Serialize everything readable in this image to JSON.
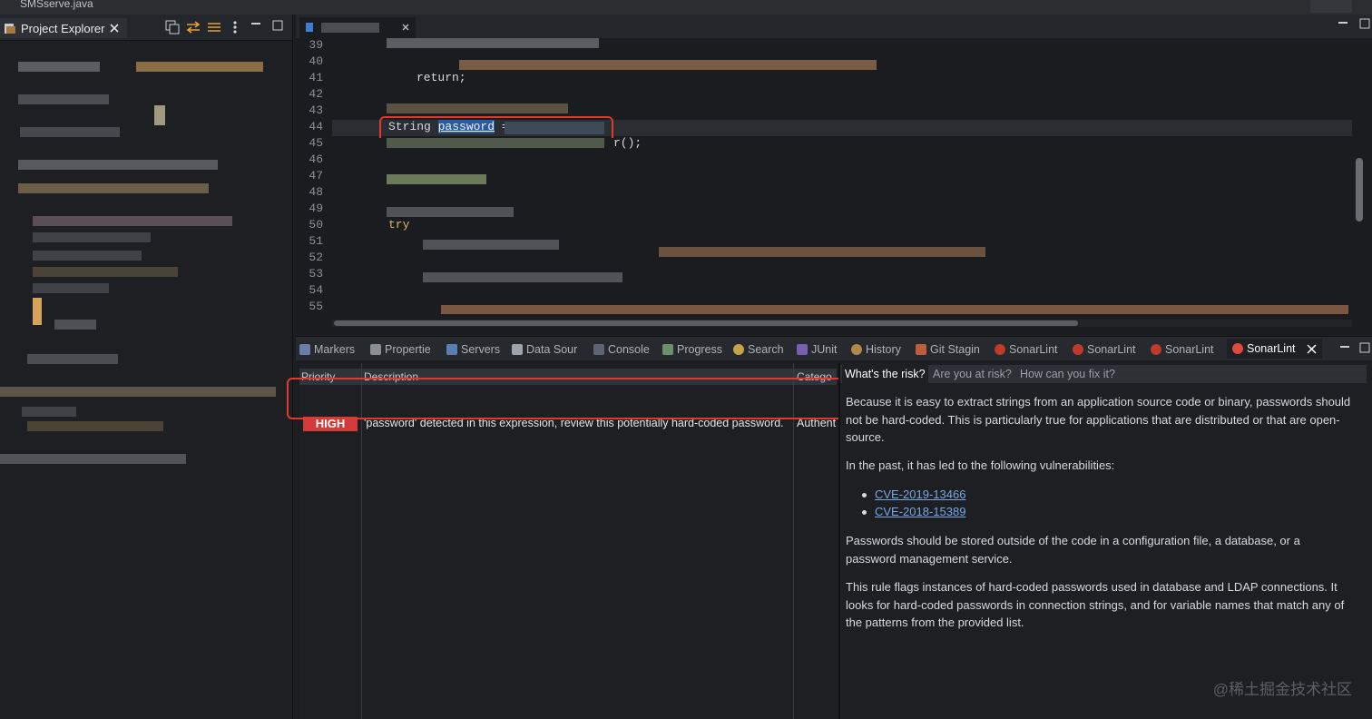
{
  "window": {
    "title": "SMSserve.java"
  },
  "explorer": {
    "tab_label": "Project Explorer"
  },
  "editor": {
    "line_numbers": [
      "39",
      "40",
      "41",
      "42",
      "43",
      "44",
      "45",
      "46",
      "47",
      "48",
      "49",
      "50",
      "51",
      "52",
      "53",
      "54",
      "55"
    ],
    "visible_code": {
      "return_stmt": "return;",
      "password_line_prefix": "String ",
      "password_var": "password",
      "password_line_suffix": " =",
      "line45_tail": "r();",
      "try_kw": "try"
    }
  },
  "views": {
    "tabs": [
      {
        "label": "Markers",
        "icon": "markers-icon"
      },
      {
        "label": "Propertie",
        "icon": "properties-icon"
      },
      {
        "label": "Servers",
        "icon": "servers-icon"
      },
      {
        "label": "Data Sour",
        "icon": "datasource-icon"
      },
      {
        "label": "Console",
        "icon": "console-icon"
      },
      {
        "label": "Progress",
        "icon": "progress-icon"
      },
      {
        "label": "Search",
        "icon": "search-icon"
      },
      {
        "label": "JUnit",
        "icon": "junit-icon"
      },
      {
        "label": "History",
        "icon": "history-icon"
      },
      {
        "label": "Git Stagin",
        "icon": "git-icon"
      },
      {
        "label": "SonarLint",
        "icon": "sonarlint-icon"
      },
      {
        "label": "SonarLint",
        "icon": "sonarlint-icon"
      },
      {
        "label": "SonarLint",
        "icon": "sonarlint-icon"
      },
      {
        "label": "SonarLint",
        "icon": "sonarlint-icon",
        "active": true
      }
    ]
  },
  "issues": {
    "columns": [
      "Priority",
      "Description",
      "Catego"
    ],
    "rows": [
      {
        "priority": "HIGH",
        "description": "'password' detected in this expression, review this potentially hard-coded password.",
        "category": "Authent"
      }
    ]
  },
  "details": {
    "tabs": [
      "What's the risk?",
      "Are you at risk?",
      "How can you fix it?"
    ],
    "paragraphs": [
      "Because it is easy to extract strings from an application source code or binary, passwords should not be hard-coded. This is particularly true for applications that are distributed or that are open-source.",
      "In the past, it has led to the following vulnerabilities:",
      "Passwords should be stored outside of the code in a configuration file, a database, or a password management service.",
      "This rule flags instances of hard-coded passwords used in database and LDAP connections. It looks for hard-coded passwords in connection strings, and for variable names that match any of the patterns from the provided list."
    ],
    "links": [
      "CVE-2019-13466",
      "CVE-2018-15389"
    ]
  },
  "watermark": "@稀土掘金技术社区",
  "colors": {
    "badge_high": "#d33a3a",
    "annotation": "#e03a2e",
    "link": "#78a7e6"
  }
}
